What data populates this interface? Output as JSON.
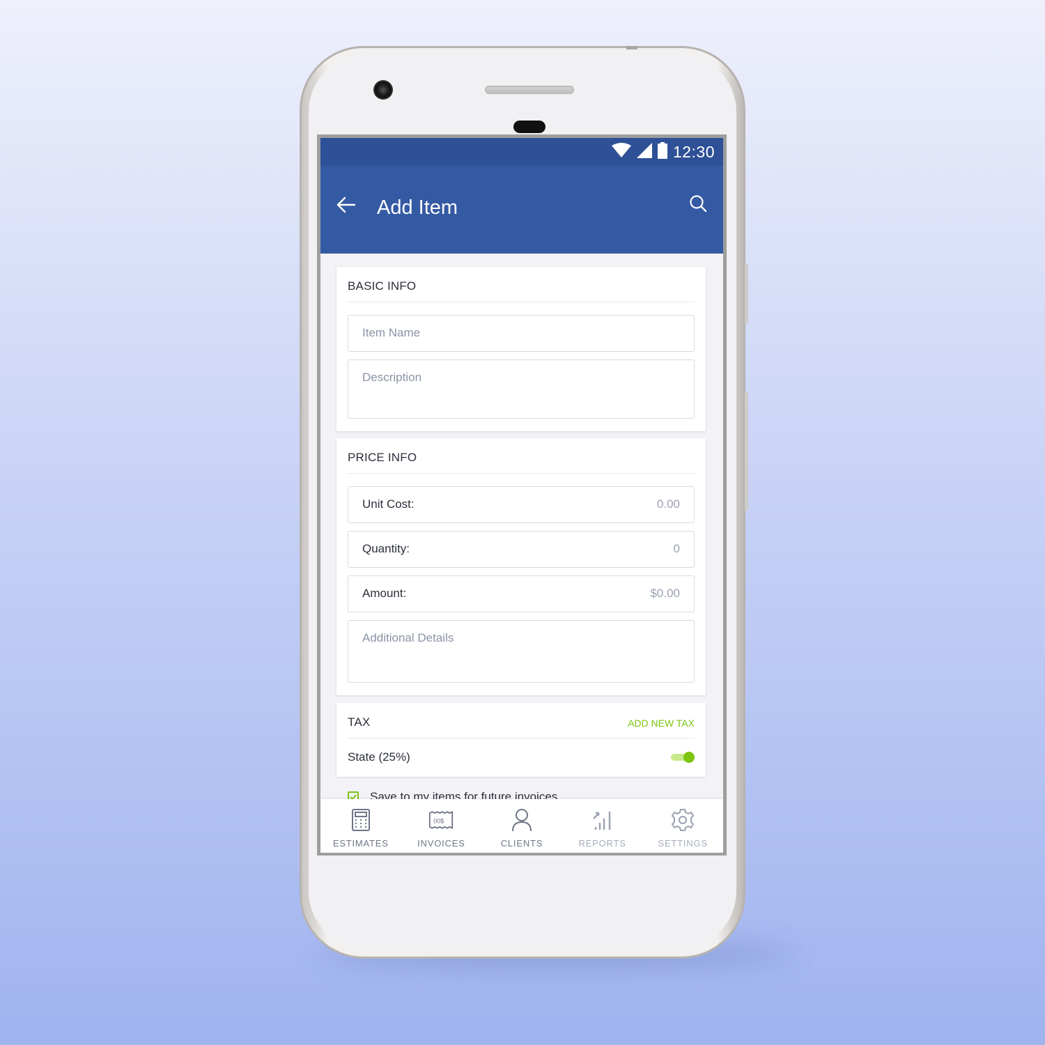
{
  "status_bar": {
    "time": "12:30",
    "icons": [
      "wifi-icon",
      "cell-signal-icon",
      "battery-icon"
    ]
  },
  "app_bar": {
    "title": "Add Item",
    "back_icon": "arrow-left-icon",
    "search_icon": "search-icon"
  },
  "basic_info": {
    "title": "BASIC INFO",
    "item_name_placeholder": "Item Name",
    "description_placeholder": "Description"
  },
  "price_info": {
    "title": "PRICE INFO",
    "unit_cost_label": "Unit Cost:",
    "unit_cost_value": "0.00",
    "quantity_label": "Quantity:",
    "quantity_value": "0",
    "amount_label": "Amount:",
    "amount_value": "$0.00",
    "additional_details_placeholder": "Additional Details"
  },
  "tax": {
    "title": "TAX",
    "add_new_label": "ADD NEW TAX",
    "items": [
      {
        "label": "State (25%)",
        "enabled": true
      }
    ]
  },
  "save_option": {
    "label": "Save to my items for future invoices",
    "checked": true
  },
  "bottom_nav": {
    "items": [
      {
        "label": "ESTIMATES",
        "icon": "calculator-icon"
      },
      {
        "label": "INVOICES",
        "icon": "invoice-icon"
      },
      {
        "label": "CLIENTS",
        "icon": "person-icon"
      },
      {
        "label": "REPORTS",
        "icon": "chart-icon"
      },
      {
        "label": "SETTINGS",
        "icon": "gear-icon"
      }
    ]
  },
  "colors": {
    "primary": "#355aa4",
    "status_bar": "#2e5096",
    "accent_green": "#7cc411",
    "text_dark": "#2b2f3a",
    "placeholder": "#8b93a6"
  }
}
